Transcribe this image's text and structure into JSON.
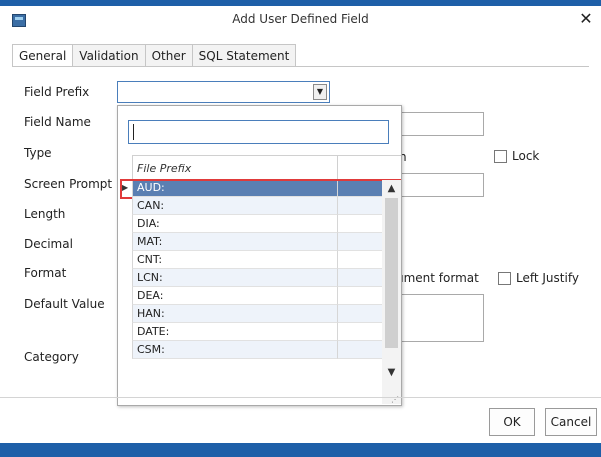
{
  "window": {
    "title": "Add User Defined Field",
    "close_glyph": "✕"
  },
  "tabs": [
    {
      "label": "General"
    },
    {
      "label": "Validation"
    },
    {
      "label": "Other"
    },
    {
      "label": "SQL Statement"
    }
  ],
  "form_labels": {
    "field_prefix": "Field Prefix",
    "field_name": "Field Name",
    "type": "Type",
    "screen_prompt": "Screen Prompt",
    "length": "Length",
    "decimal": "Decimal",
    "format": "Format",
    "default_value": "Default Value",
    "category": "Category"
  },
  "field_prefix": {
    "value": ""
  },
  "right_fragments": {
    "type_fragment": "n",
    "format_fragment": "ument format"
  },
  "checkboxes": {
    "lock": {
      "label": "Lock",
      "checked": false
    },
    "left_justify": {
      "label": "Left Justify",
      "checked": false
    }
  },
  "dropdown": {
    "search_value": "",
    "column_header": "File Prefix",
    "items": [
      "AUD:",
      "CAN:",
      "DIA:",
      "MAT:",
      "CNT:",
      "LCN:",
      "DEA:",
      "HAN:",
      "DATE:",
      "CSM:"
    ],
    "selected": "AUD:"
  },
  "buttons": {
    "ok": "OK",
    "cancel": "Cancel"
  },
  "colors": {
    "accent": "#1e5fa8",
    "selection": "#5a7fb2",
    "highlight": "#e03a3a"
  }
}
